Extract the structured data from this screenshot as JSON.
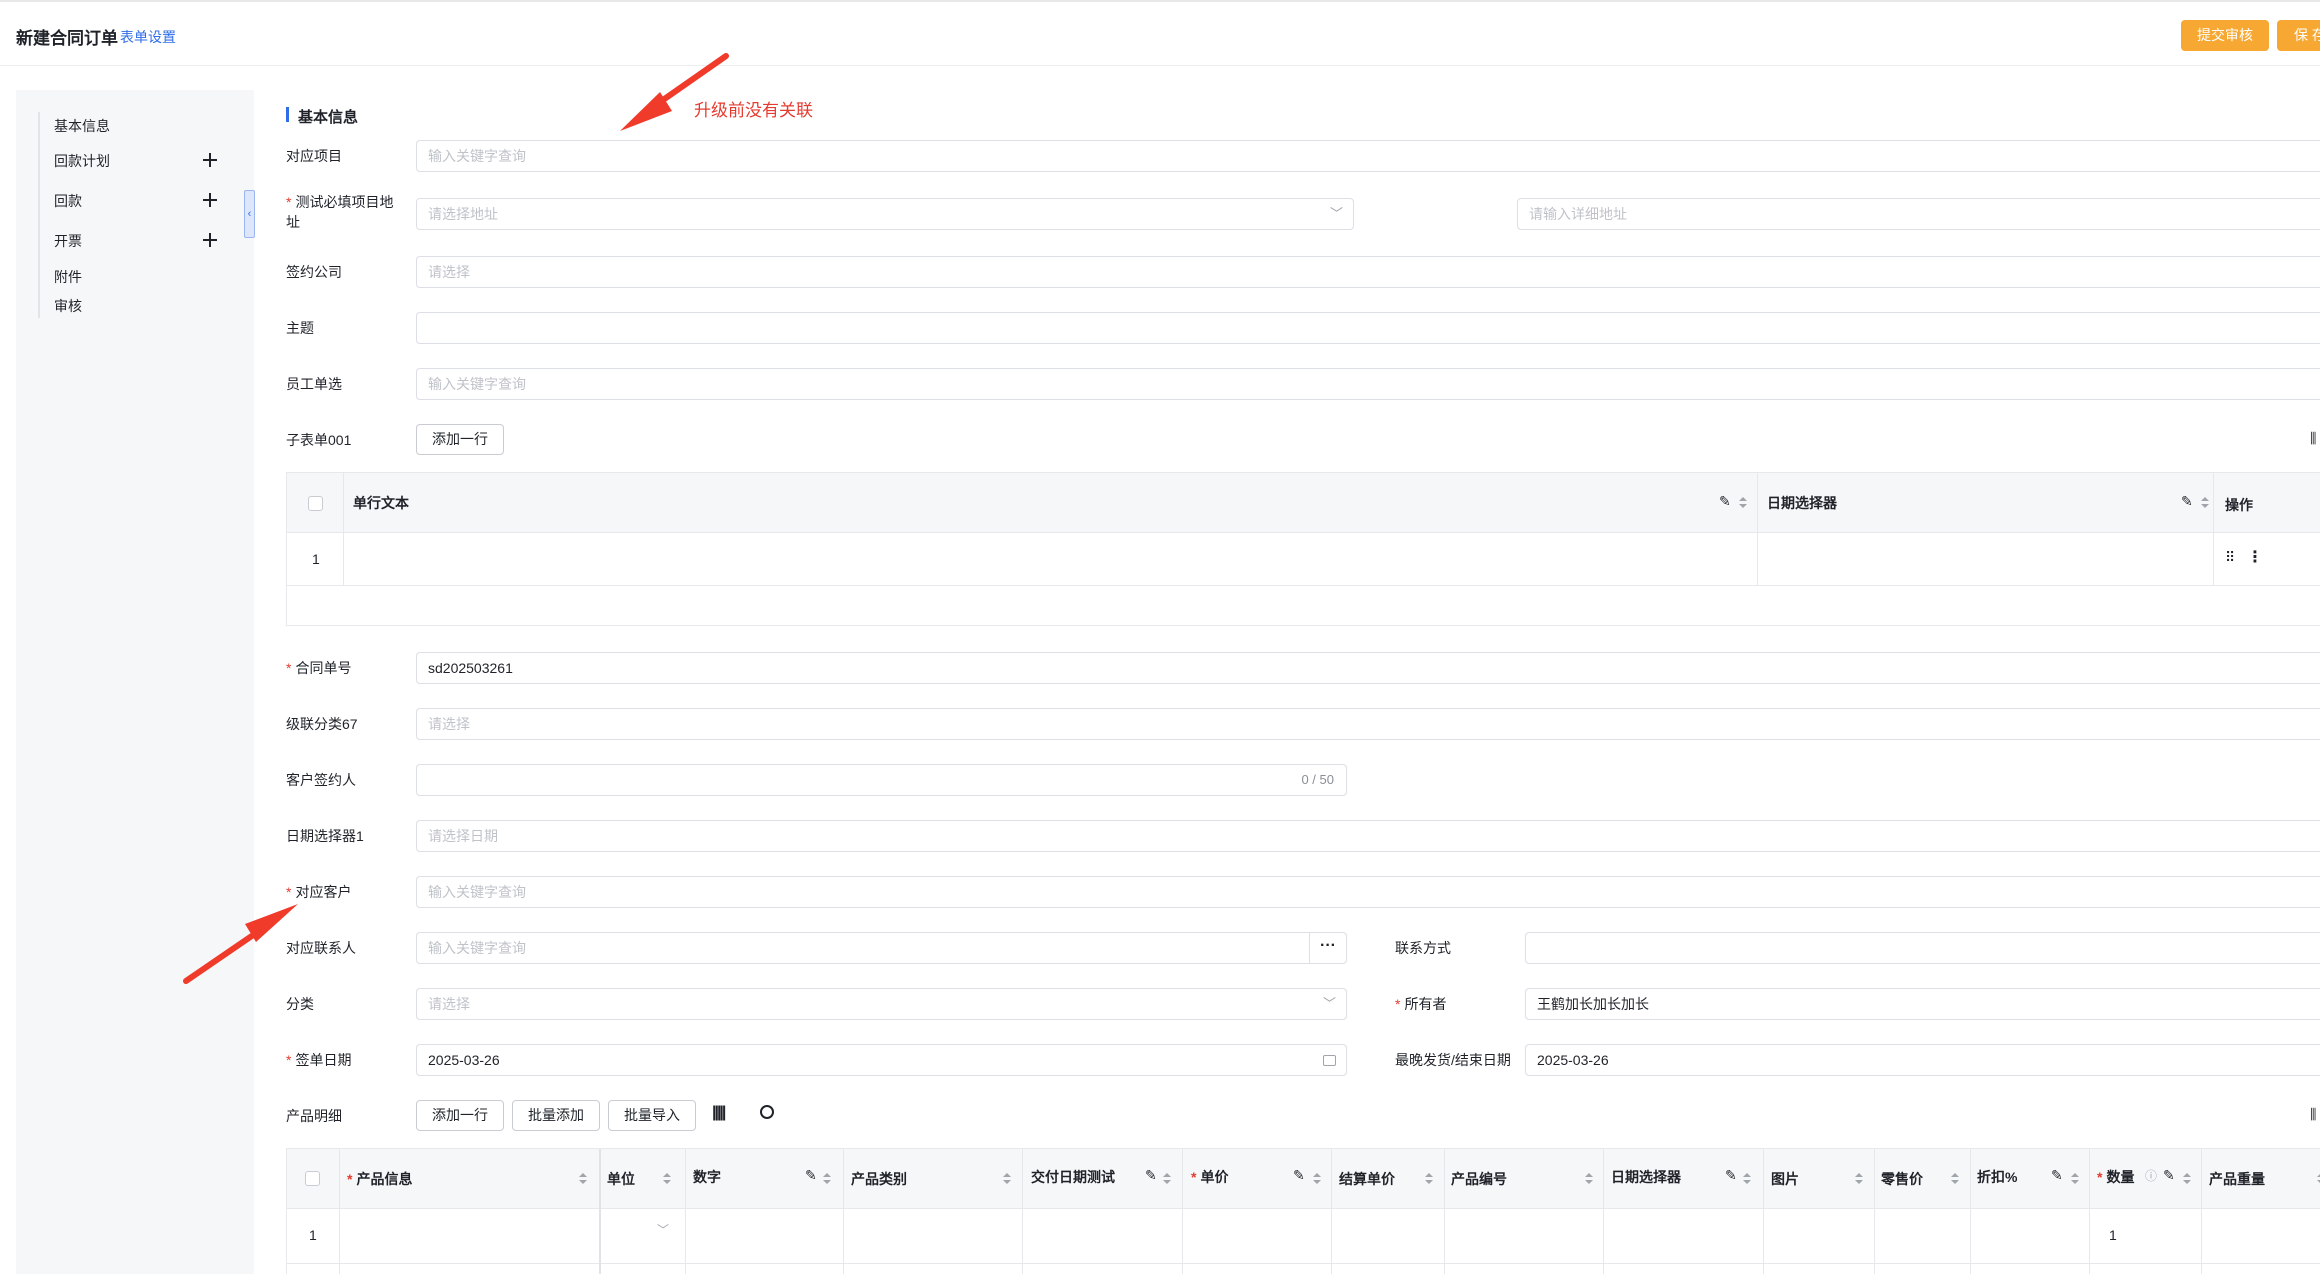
{
  "header": {
    "title": "新建合同订单",
    "form_settings": "表单设置",
    "submit_label": "提交审核",
    "save_label": "保 存"
  },
  "sidebar": {
    "items": [
      {
        "label": "基本信息"
      },
      {
        "label": "回款计划",
        "has_add": true
      },
      {
        "label": "回款",
        "has_add": true
      },
      {
        "label": "开票",
        "has_add": true
      },
      {
        "label": "附件"
      },
      {
        "label": "审核"
      }
    ]
  },
  "section": {
    "title": "基本信息"
  },
  "annotation": {
    "text": "升级前没有关联",
    "color": "#e53b2f"
  },
  "fields": {
    "project": {
      "label": "对应项目",
      "placeholder": "输入关键字查询"
    },
    "address": {
      "label": "测试必填项目地址",
      "required": true,
      "placeholder": "请选择地址",
      "detail_placeholder": "请输入详细地址"
    },
    "company": {
      "label": "签约公司",
      "placeholder": "请选择"
    },
    "subject": {
      "label": "主题",
      "value": ""
    },
    "employee": {
      "label": "员工单选",
      "placeholder": "输入关键字查询"
    },
    "subform": {
      "label": "子表单001",
      "add_row": "添加一行"
    },
    "contract_no": {
      "label": "合同单号",
      "required": true,
      "value": "sd202503261"
    },
    "cascade": {
      "label": "级联分类67",
      "placeholder": "请选择"
    },
    "signer": {
      "label": "客户签约人",
      "counter": "0 / 50"
    },
    "date1": {
      "label": "日期选择器1",
      "placeholder": "请选择日期"
    },
    "customer": {
      "label": "对应客户",
      "required": true,
      "placeholder": "输入关键字查询"
    },
    "contact": {
      "label": "对应联系人",
      "placeholder": "输入关键字查询"
    },
    "contact_method": {
      "label": "联系方式",
      "value": ""
    },
    "category": {
      "label": "分类",
      "placeholder": "请选择"
    },
    "owner": {
      "label": "所有者",
      "required": true,
      "value": "王鹤加长加长加长"
    },
    "sign_date": {
      "label": "签单日期",
      "required": true,
      "value": "2025-03-26"
    },
    "latest_date": {
      "label": "最晚发货/结束日期",
      "value": "2025-03-26"
    },
    "products": {
      "label": "产品明细",
      "add_row": "添加一行",
      "batch_add": "批量添加",
      "batch_import": "批量导入"
    }
  },
  "subtable": {
    "columns": [
      "单行文本",
      "日期选择器",
      "操作"
    ],
    "rows": [
      {
        "no": "1"
      }
    ]
  },
  "product_table": {
    "columns": [
      "产品信息",
      "单位",
      "数字",
      "产品类别",
      "交付日期测试",
      "单价",
      "结算单价",
      "产品编号",
      "日期选择器",
      "图片",
      "零售价",
      "折扣%",
      "数量",
      "产品重量"
    ],
    "rows": [
      {
        "no": "1",
        "quantity": "1"
      }
    ]
  }
}
